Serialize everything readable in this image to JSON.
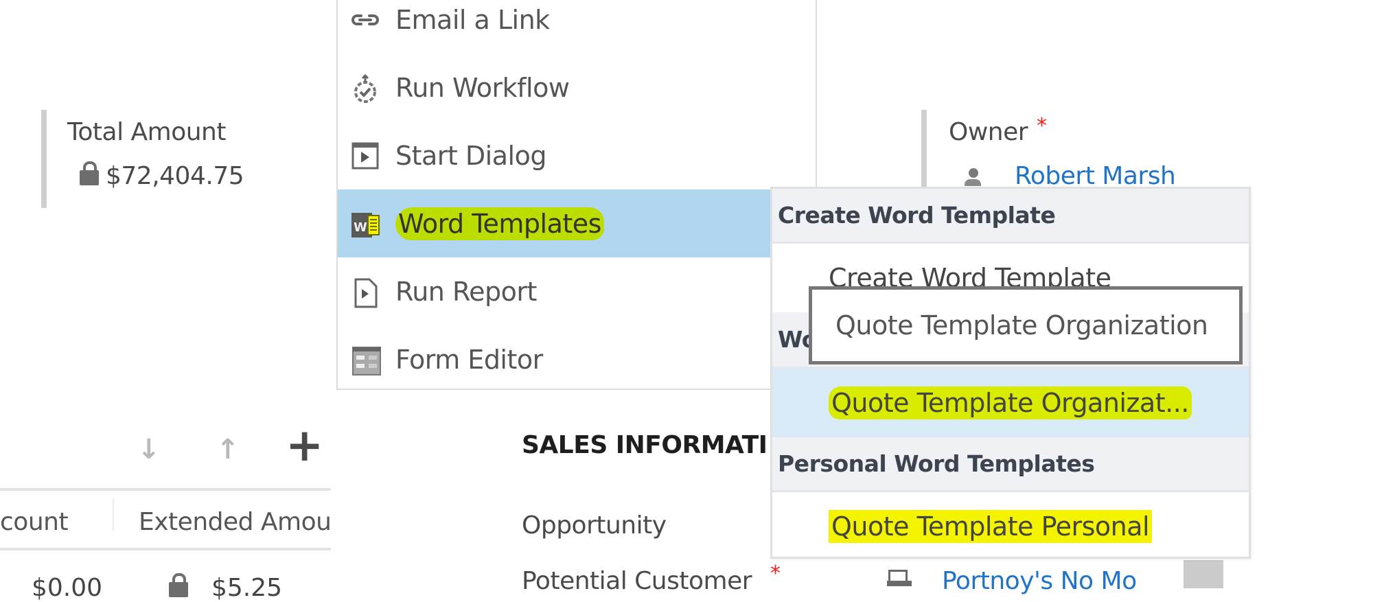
{
  "form": {
    "total_amount": {
      "label": "Total Amount",
      "value": "$72,404.75",
      "locked": true
    },
    "owner": {
      "label": "Owner",
      "required_marker": "*",
      "value": "Robert Marsh",
      "icon": "user-icon"
    },
    "sales_information": {
      "title": "SALES INFORMATI",
      "fields": [
        {
          "label": "Opportunity",
          "value": ""
        },
        {
          "label": "Potential Customer",
          "required_marker": "*",
          "value": "Portnoy's No Mo",
          "icon": "account-icon"
        }
      ]
    }
  },
  "grid": {
    "toolbar": {
      "move_down": "↓",
      "move_up": "↑",
      "add": "+"
    },
    "columns": [
      "count",
      "Extended Amou"
    ],
    "rows": [
      {
        "discount": "$0.00",
        "extended_amount": "$5.25",
        "extended_locked": true
      }
    ]
  },
  "menu": {
    "items": [
      {
        "label": "Email a Link",
        "icon": "link-icon"
      },
      {
        "label": "Run Workflow",
        "icon": "workflow-icon"
      },
      {
        "label": "Start Dialog",
        "icon": "dialog-icon"
      },
      {
        "label": "Word Templates",
        "icon": "word-icon",
        "active": true
      },
      {
        "label": "Run Report",
        "icon": "report-icon"
      },
      {
        "label": "Form Editor",
        "icon": "form-editor-icon"
      }
    ]
  },
  "submenu": {
    "sections": [
      {
        "header": "Create Word Template",
        "items": [
          "Create Word Template"
        ]
      },
      {
        "header": "Word Templates",
        "items": [
          "Quote Template Organizat..."
        ]
      },
      {
        "header": "Personal Word Templates",
        "items": [
          "Quote Template Personal"
        ]
      }
    ],
    "tooltip": "Quote Template Organization"
  },
  "colors": {
    "menu_active_bg": "#b1d6f0",
    "submenu_active_bg": "#d9eaf7",
    "submenu_header_bg": "#eff1f5",
    "link": "#1f73c9",
    "required": "#ff1a1a",
    "highlight_green": "#bddc00",
    "highlight_yellow": "#f4f400"
  }
}
